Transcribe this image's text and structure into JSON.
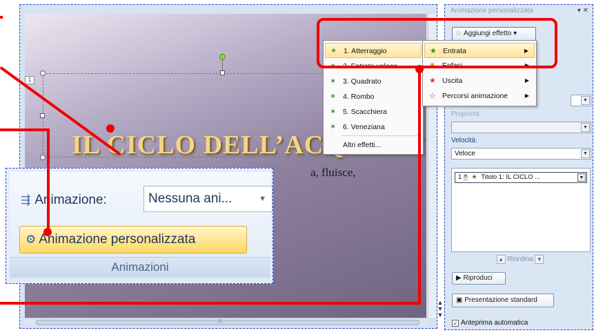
{
  "slide": {
    "placeholder_number": "1",
    "title": "IL CICLO DELL’ACQ",
    "subtitle": "a, fluisce,"
  },
  "task_pane": {
    "title": "Animazione personalizzata",
    "add_effect_label": "Aggiungi effetto",
    "property_label": "Proprietà:",
    "speed_label": "Velocità:",
    "speed_value": "Veloce",
    "list_item": {
      "order": "1",
      "text": "Titolo 1: IL CICLO ..."
    },
    "reorder_label": "Riordina",
    "play_label": "Riproduci",
    "slideshow_label": "Presentazione standard",
    "autopreview_label": "Anteprima automatica",
    "autopreview_checked": true
  },
  "effect_menu": {
    "items": [
      {
        "label": "Entrata",
        "icon": "entrance-star-icon",
        "has_submenu": true
      },
      {
        "label": "Enfasi",
        "icon": "emphasis-star-icon",
        "has_submenu": true
      },
      {
        "label": "Uscita",
        "icon": "exit-star-icon",
        "has_submenu": true
      },
      {
        "label": "Percorsi animazione",
        "icon": "motion-path-icon",
        "has_submenu": true
      }
    ]
  },
  "entrance_submenu": {
    "items": [
      {
        "label": "1. Atterraggio"
      },
      {
        "label": "2. Entrata veloce"
      },
      {
        "label": "3. Quadrato"
      },
      {
        "label": "4. Rombo"
      },
      {
        "label": "5. Scacchiera"
      },
      {
        "label": "6. Veneziana"
      }
    ],
    "more_label": "Altri effetti..."
  },
  "ribbon_inset": {
    "animation_label": "Animazione:",
    "animation_value": "Nessuna ani...",
    "custom_animation_button": "Animazione personalizzata",
    "group_label": "Animazioni"
  },
  "colors": {
    "callout": "#ee0000",
    "highlight": "#ffe39a",
    "slide_title": "#f3d58a"
  }
}
